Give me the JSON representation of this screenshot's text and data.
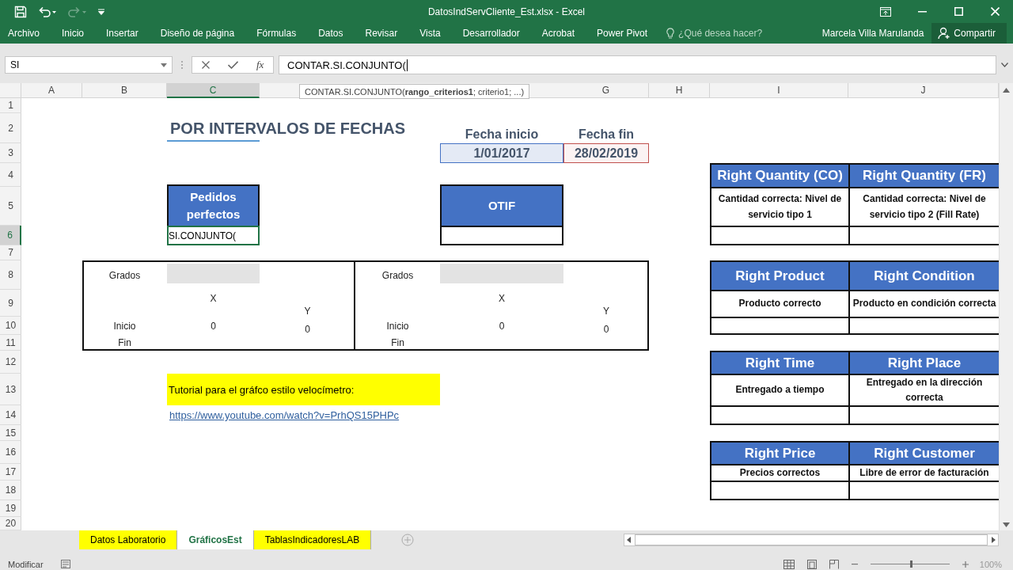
{
  "window": {
    "title": "DatosIndServCliente_Est.xlsx - Excel"
  },
  "quick_access": [
    {
      "kind": "save",
      "disabled": false
    },
    {
      "kind": "undo",
      "disabled": false
    },
    {
      "kind": "redo",
      "disabled": true
    }
  ],
  "ribbon": {
    "tabs": [
      "Archivo",
      "Inicio",
      "Insertar",
      "Diseño de página",
      "Fórmulas",
      "Datos",
      "Revisar",
      "Vista",
      "Desarrollador",
      "Acrobat",
      "Power Pivot"
    ],
    "tell_me": {
      "placeholder": "¿Qué desea hacer?"
    },
    "user": "Marcela Villa Marulanda",
    "share_button": "Compartir"
  },
  "formula_bar": {
    "name_box": "SI",
    "function_button": "fx",
    "formula": "CONTAR.SI.CONJUNTO(",
    "tooltip": "CONTAR.SI.CONJUNTO(**rango_criterios1**; criterio1; ...)"
  },
  "column_headers": [
    {
      "label": "A",
      "selected": false
    },
    {
      "label": "B",
      "selected": false
    },
    {
      "label": "C",
      "selected": true
    },
    {
      "label": "G",
      "selected": false
    },
    {
      "label": "H",
      "selected": false
    },
    {
      "label": "I",
      "selected": false
    },
    {
      "label": "J",
      "selected": false
    }
  ],
  "row_headers": [
    {
      "label": "1",
      "selected": false
    },
    {
      "label": "2",
      "selected": false
    },
    {
      "label": "3",
      "selected": false
    },
    {
      "label": "4",
      "selected": false
    },
    {
      "label": "5",
      "selected": false
    },
    {
      "label": "6",
      "selected": true
    },
    {
      "label": "7",
      "selected": false
    },
    {
      "label": "8",
      "selected": false
    },
    {
      "label": "9",
      "selected": false
    },
    {
      "label": "10",
      "selected": false
    },
    {
      "label": "11",
      "selected": false
    },
    {
      "label": "12",
      "selected": false
    },
    {
      "label": "13",
      "selected": false
    },
    {
      "label": "14",
      "selected": false
    },
    {
      "label": "15",
      "selected": false
    },
    {
      "label": "16",
      "selected": false
    },
    {
      "label": "17",
      "selected": false
    },
    {
      "label": "18",
      "selected": false
    },
    {
      "label": "19",
      "selected": false
    },
    {
      "label": "20",
      "selected": false
    }
  ],
  "sheet": {
    "title": "POR INTERVALOS DE FECHAS",
    "date_range": {
      "start_label": "Fecha inicio",
      "end_label": "Fecha fin",
      "start": "1/01/2017",
      "end": "28/02/2019"
    },
    "kpi_boxes": [
      {
        "title": "Pedidos perfectos",
        "value": "SI.CONJUNTO(",
        "selected": true
      },
      {
        "title": "OTIF",
        "selected": false
      }
    ],
    "gauge_tables": [
      {
        "degrees_label": "Grados",
        "x_label": "X",
        "y_label": "Y",
        "start_label": "Inicio",
        "x_value": "0",
        "y_value": "0",
        "end_label": "Fin"
      },
      {
        "degrees_label": "Grados",
        "x_label": "X",
        "y_label": "Y",
        "start_label": "Inicio",
        "x_value": "0",
        "y_value": "0",
        "end_label": "Fin"
      }
    ],
    "tutorial": {
      "text": "Tutorial para el gráfco estilo velocímetro:",
      "link": "https://www.youtube.com/watch?v=PrhQS15PHPc"
    },
    "indicator_tables": [
      {
        "columns": [
          {
            "title": "Right Quantity (CO)",
            "description": "Cantidad correcta: Nivel de servicio tipo 1"
          },
          {
            "title": "Right Quantity (FR)",
            "description": "Cantidad correcta: Nivel de servicio tipo 2 (Fill Rate)"
          }
        ]
      },
      {
        "columns": [
          {
            "title": "Right Product",
            "description": "Producto correcto"
          },
          {
            "title": "Right Condition",
            "description": "Producto en condición correcta"
          }
        ]
      },
      {
        "columns": [
          {
            "title": "Right Time",
            "description": "Entregado a tiempo"
          },
          {
            "title": "Right Place",
            "description": "Entregado en la dirección correcta"
          }
        ]
      },
      {
        "columns": [
          {
            "title": "Right Price",
            "description": "Precios correctos"
          },
          {
            "title": "Right Customer",
            "description": "Libre de error de facturación"
          }
        ]
      }
    ]
  },
  "sheet_tabs": [
    {
      "label": "Datos Laboratorio",
      "selected": false,
      "color": "#ffff00"
    },
    {
      "label": "GráficosEst",
      "selected": true
    },
    {
      "label": "TablasIndicadoresLAB",
      "selected": false,
      "color": "#ffff00"
    }
  ],
  "status_bar": {
    "mode": "Modificar",
    "zoom_slider": {
      "level": 0.5
    },
    "zoom": "100%"
  }
}
